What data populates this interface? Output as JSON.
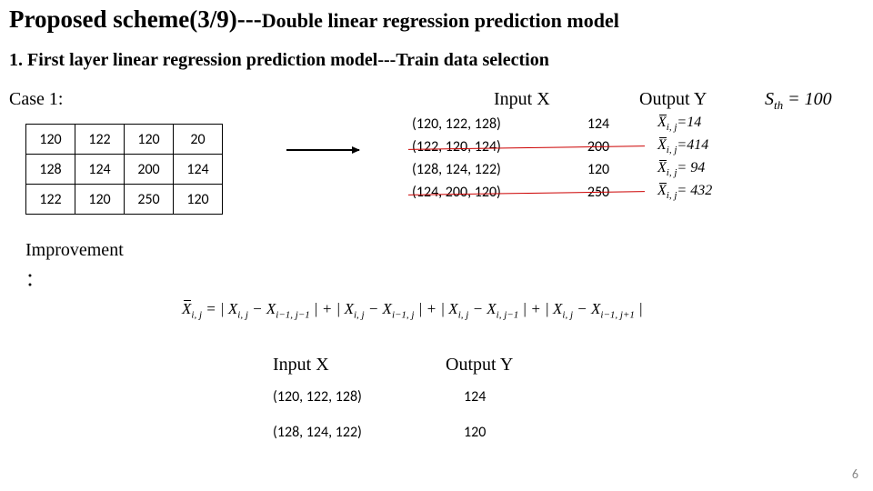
{
  "title": {
    "main": "Proposed scheme(3/9)---",
    "sub": "Double linear regression prediction model"
  },
  "section": "1. First layer linear regression prediction model---Train data selection",
  "case_label": "Case 1:",
  "labels": {
    "input": "Input X",
    "output": "Output Y",
    "sth_pre": "S",
    "sth_sub": "th",
    "sth_post": " = 100"
  },
  "matrix": [
    [
      "120",
      "122",
      "120",
      "20"
    ],
    [
      "128",
      "124",
      "200",
      "124"
    ],
    [
      "122",
      "120",
      "250",
      "120"
    ]
  ],
  "triples": [
    {
      "t": "(120, 122, 128)",
      "y": "124",
      "xbar": "=14",
      "strike": false
    },
    {
      "t": "(122, 120, 124)",
      "y": "200",
      "xbar": "=414",
      "strike": true
    },
    {
      "t": "(128, 124, 122)",
      "y": "120",
      "xbar": "= 94",
      "strike": false
    },
    {
      "t": "(124, 200, 120)",
      "y": "250",
      "xbar": "= 432",
      "strike": true
    }
  ],
  "xbar_label": {
    "sym": "X̄",
    "sub": "i, j"
  },
  "improve_label": "Improvement",
  "improve_colon": "：",
  "formula": {
    "lhs_sym": "X̄",
    "lhs_sub": "i, j",
    "terms": [
      {
        "a_sub": "i, j",
        "b_sub": "i−1, j−1"
      },
      {
        "a_sub": "i, j",
        "b_sub": "i−1, j"
      },
      {
        "a_sub": "i, j",
        "b_sub": "i, j−1"
      },
      {
        "a_sub": "i, j",
        "b_sub": "i−1, j+1"
      }
    ]
  },
  "bottom": {
    "input_label": "Input X",
    "output_label": "Output Y",
    "rows": [
      {
        "t": "(120, 122, 128)",
        "y": "124"
      },
      {
        "t": "(128, 124, 122)",
        "y": "120"
      }
    ]
  },
  "page": "6"
}
